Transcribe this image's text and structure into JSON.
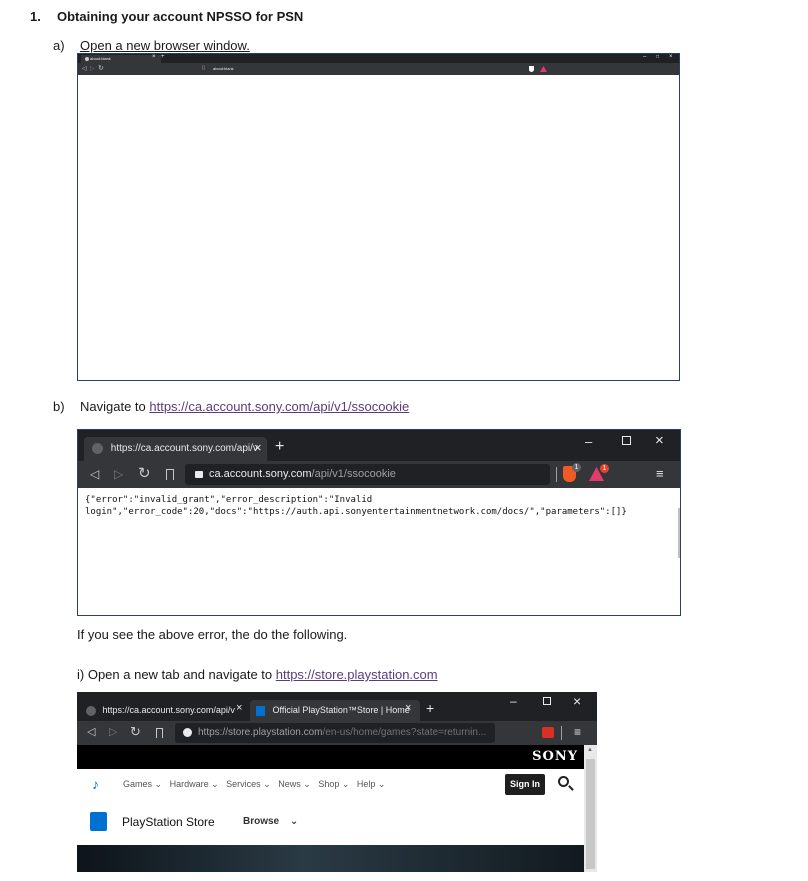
{
  "heading": {
    "number": "1.",
    "title": "Obtaining your account NPSSO for PSN"
  },
  "step_a": {
    "marker": "a)",
    "text": "Open a new browser window."
  },
  "browser_a": {
    "tab_title": "about:blank",
    "url": "about:blank"
  },
  "step_b": {
    "marker": "b)",
    "prefix": "Navigate to ",
    "link": "https://ca.account.sony.com/api/v1/ssocookie"
  },
  "browser_b": {
    "tab_title": "https://ca.account.sony.com/api/v",
    "url_host": "ca.account.sony.com",
    "url_path": "/api/v1/ssocookie",
    "brave_badge": "1",
    "rewards_badge": "1",
    "response_line1": "{\"error\":\"invalid_grant\",\"error_description\":\"Invalid",
    "response_line2": "login\",\"error_code\":20,\"docs\":\"https://auth.api.sonyentertainmentnetwork.com/docs/\",\"parameters\":[]}"
  },
  "note": "If you see the above error, the do the following.",
  "step_i": {
    "prefix": "i) Open a new tab and navigate to ",
    "link": "https://store.playstation.com"
  },
  "browser_c": {
    "tab1_title": "https://ca.account.sony.com/api/v",
    "tab2_title": "Official PlayStation™Store | Home",
    "url_host": "https://store.playstation.com",
    "url_path": "/en-us/home/games?state=returnin...",
    "sony_logo": "SONY",
    "nav": [
      "Games",
      "Hardware",
      "Services",
      "News",
      "Shop",
      "Help"
    ],
    "sign_in": "Sign In",
    "store_name": "PlayStation Store",
    "browse": "Browse"
  },
  "colors": {
    "link": "#5a3d7a",
    "browser_dark": "#202124",
    "toolbar": "#35363a",
    "ps_blue": "#0070d1"
  }
}
